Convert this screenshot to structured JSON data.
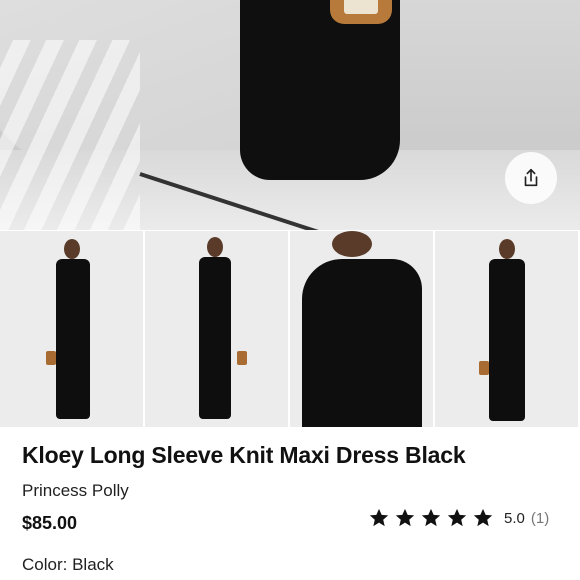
{
  "hero": {
    "image_alt": "model wearing black maxi dress"
  },
  "share": {
    "icon": "share-icon"
  },
  "thumbnails": [
    {
      "name": "front",
      "selected": false
    },
    {
      "name": "side",
      "selected": false
    },
    {
      "name": "closeup",
      "selected": false
    },
    {
      "name": "front-full",
      "selected": false
    }
  ],
  "product": {
    "title": "Kloey Long Sleeve Knit Maxi Dress Black",
    "brand": "Princess Polly",
    "price": "$85.00",
    "rating": {
      "value": "5.0",
      "count": "(1)",
      "stars": 5
    },
    "color_label": "Color:",
    "color_value": "Black"
  },
  "colors": {
    "star": "#111111",
    "text": "#111111",
    "muted": "#777777"
  }
}
